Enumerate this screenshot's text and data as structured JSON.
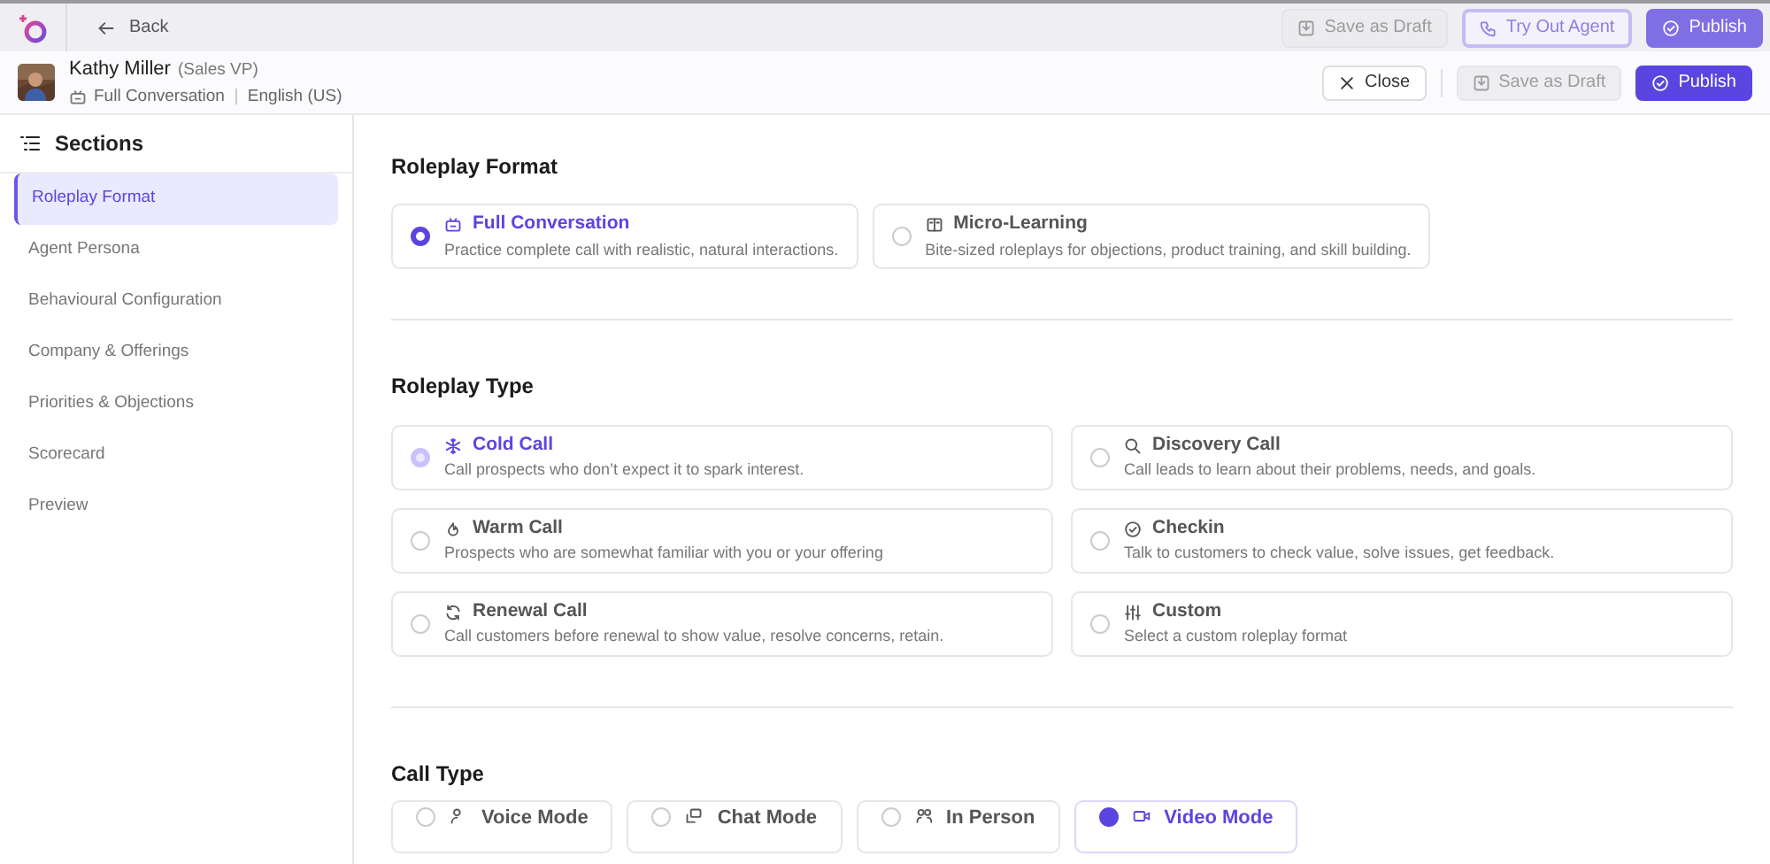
{
  "top_bar": {
    "back": "Back",
    "buttons": [
      {
        "label": "Save as Draft",
        "kind": "draft",
        "disabled": true
      },
      {
        "label": "Try Out Agent",
        "kind": "try",
        "disabled": false
      },
      {
        "label": "Publish",
        "kind": "publish",
        "disabled": false
      }
    ]
  },
  "header": {
    "name": "Kathy Miller",
    "role": "(Sales VP)",
    "format": "Full Conversation",
    "language": "English (US)",
    "buttons": [
      {
        "label": "Close",
        "kind": "close",
        "disabled": false
      },
      {
        "label": "Save as Draft",
        "kind": "draft",
        "disabled": true
      },
      {
        "label": "Publish",
        "kind": "publish",
        "disabled": false
      }
    ]
  },
  "sidebar": {
    "title": "Sections",
    "items": [
      {
        "label": "Roleplay Format",
        "selected": true
      },
      {
        "label": "Agent Persona",
        "selected": false
      },
      {
        "label": "Behavioural Configuration",
        "selected": false
      },
      {
        "label": "Company & Offerings",
        "selected": false
      },
      {
        "label": "Priorities & Objections",
        "selected": false
      },
      {
        "label": "Scorecard",
        "selected": false
      },
      {
        "label": "Preview",
        "selected": false
      }
    ]
  },
  "sections": [
    {
      "title": "Roleplay Format",
      "options": [
        {
          "title": "Full Conversation",
          "description": "Practice complete call with realistic, natural interactions.",
          "selected": true
        },
        {
          "title": "Micro-Learning",
          "description": "Bite-sized roleplays for objections, product training, and skill building.",
          "selected": false
        }
      ]
    },
    {
      "title": "Roleplay Type",
      "options": [
        {
          "title": "Cold Call",
          "description": "Call prospects who don’t expect it to spark interest.",
          "selected": true
        },
        {
          "title": "Discovery Call",
          "description": "Call leads to learn about their problems, needs, and goals.",
          "selected": false
        },
        {
          "title": "Warm Call",
          "description": "Prospects who are somewhat familiar with you or your offering",
          "selected": false
        },
        {
          "title": "Checkin",
          "description": "Talk to customers to check value, solve issues, get feedback.",
          "selected": false
        },
        {
          "title": "Renewal Call",
          "description": "Call customers before renewal to show value, resolve concerns, retain.",
          "selected": false
        },
        {
          "title": "Custom",
          "description": "Select a custom roleplay format",
          "selected": false
        }
      ]
    },
    {
      "title": "Call Type",
      "options": [
        {
          "title": "Voice Mode",
          "selected": false
        },
        {
          "title": "Chat Mode",
          "selected": false
        },
        {
          "title": "In Person",
          "selected": false
        },
        {
          "title": "Video Mode",
          "selected": true
        }
      ]
    }
  ]
}
